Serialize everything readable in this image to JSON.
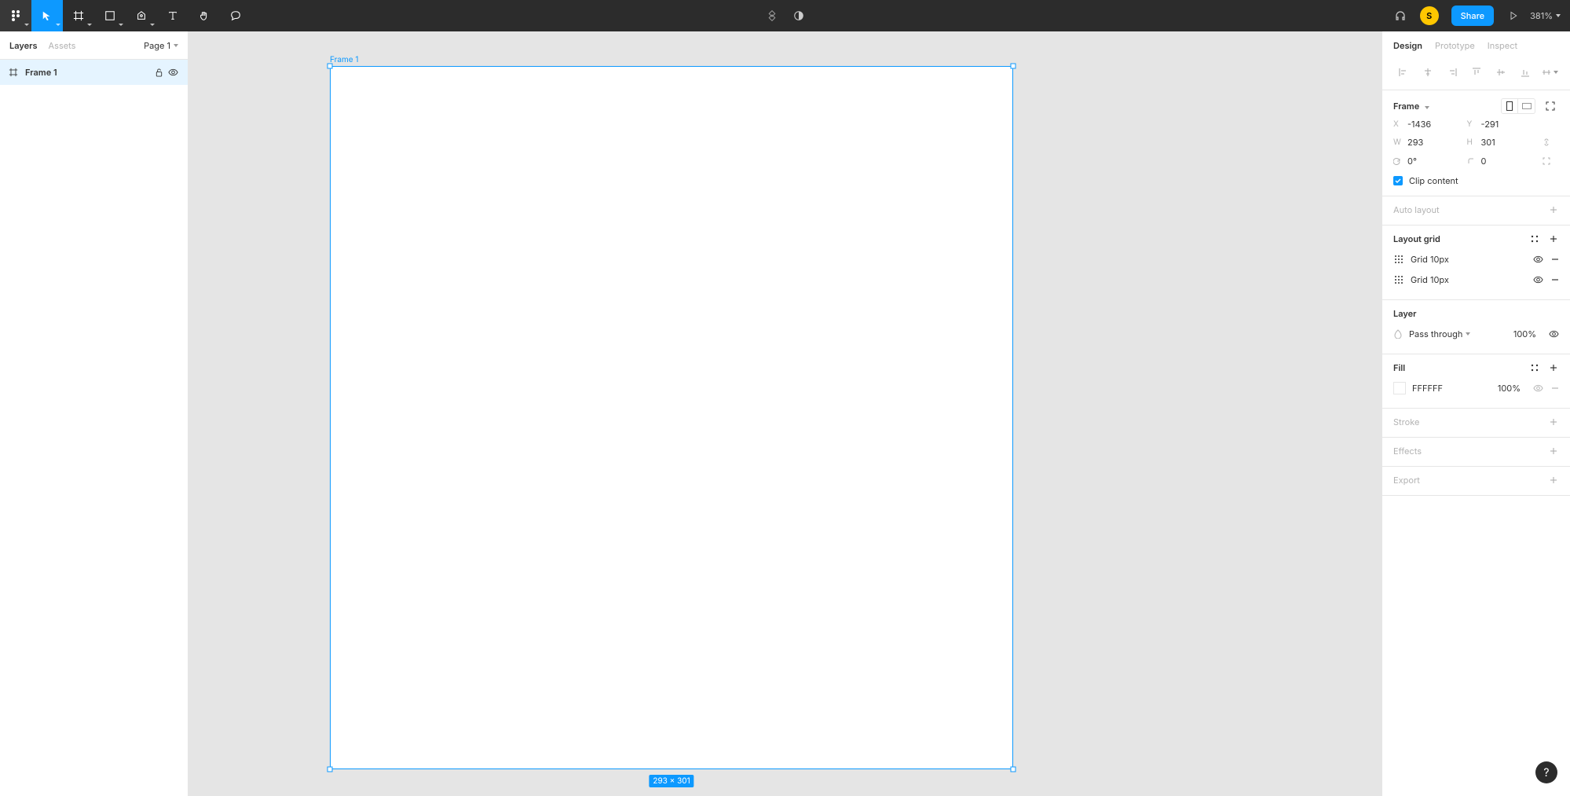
{
  "toolbar": {
    "zoom": "381%",
    "share_label": "Share",
    "avatar_initial": "S"
  },
  "left_panel": {
    "tab_layers": "Layers",
    "tab_assets": "Assets",
    "page_label": "Page 1",
    "layers": [
      {
        "name": "Frame 1"
      }
    ]
  },
  "canvas": {
    "frame_label": "Frame 1",
    "size_badge": "293 × 301"
  },
  "right_panel": {
    "tab_design": "Design",
    "tab_prototype": "Prototype",
    "tab_inspect": "Inspect",
    "frame_section": {
      "title": "Frame",
      "x_label": "X",
      "x_value": "-1436",
      "y_label": "Y",
      "y_value": "-291",
      "w_label": "W",
      "w_value": "293",
      "h_label": "H",
      "h_value": "301",
      "rotation_value": "0°",
      "radius_value": "0",
      "clip_content": "Clip content"
    },
    "auto_layout": {
      "title": "Auto layout"
    },
    "layout_grid": {
      "title": "Layout grid",
      "items": [
        {
          "label": "Grid 10px"
        },
        {
          "label": "Grid 10px"
        }
      ]
    },
    "layer": {
      "title": "Layer",
      "blend_mode": "Pass through",
      "opacity": "100%"
    },
    "fill": {
      "title": "Fill",
      "hex": "FFFFFF",
      "opacity": "100%"
    },
    "stroke": {
      "title": "Stroke"
    },
    "effects": {
      "title": "Effects"
    },
    "export": {
      "title": "Export"
    }
  },
  "help_label": "?"
}
